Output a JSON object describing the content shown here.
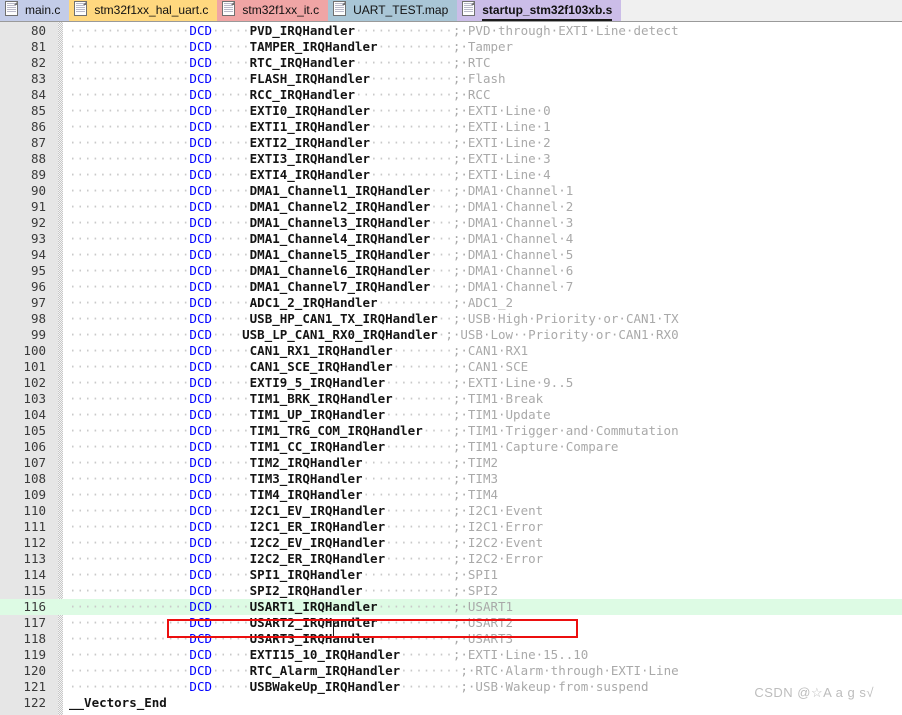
{
  "window": {
    "app": "Keil uVision editor",
    "background": "#ffffff"
  },
  "tabbar": {
    "tabs": [
      {
        "label": "main.c",
        "color": "#c3cce8",
        "icon": "document-icon",
        "active": false
      },
      {
        "label": "stm32f1xx_hal_uart.c",
        "color": "#ffd87f",
        "icon": "document-icon",
        "active": false
      },
      {
        "label": "stm32f1xx_it.c",
        "color": "#f0a5a5",
        "icon": "document-icon",
        "active": false
      },
      {
        "label": "UART_TEST.map",
        "color": "#a9c6d6",
        "icon": "document-icon",
        "active": false
      },
      {
        "label": "startup_stm32f103xb.s",
        "color": "#cbbde8",
        "icon": "document-icon",
        "active": true
      }
    ]
  },
  "editor": {
    "first_line": 80,
    "highlighted_line": 116,
    "colors": {
      "keyword": "#0000ff",
      "comment": "#a9a9a9",
      "whitespace_dot": "#c9c9c9",
      "highlight_row": "#ddfbe4",
      "annotation_box": "#ec0f0f",
      "gutter": "#e6e6e6"
    },
    "annotation": {
      "type": "red-rectangle",
      "targets_line": 116,
      "target_text": "DCD     USART1_IRQHandler          ; USART1"
    },
    "lines": [
      {
        "n": 80,
        "indent": 16,
        "kw": "DCD",
        "gap1": 5,
        "sym": "PVD_IRQHandler",
        "gap2": 13,
        "cmt": "; PVD through EXTI Line detect"
      },
      {
        "n": 81,
        "indent": 16,
        "kw": "DCD",
        "gap1": 5,
        "sym": "TAMPER_IRQHandler",
        "gap2": 10,
        "cmt": "; Tamper"
      },
      {
        "n": 82,
        "indent": 16,
        "kw": "DCD",
        "gap1": 5,
        "sym": "RTC_IRQHandler",
        "gap2": 13,
        "cmt": "; RTC"
      },
      {
        "n": 83,
        "indent": 16,
        "kw": "DCD",
        "gap1": 5,
        "sym": "FLASH_IRQHandler",
        "gap2": 11,
        "cmt": "; Flash"
      },
      {
        "n": 84,
        "indent": 16,
        "kw": "DCD",
        "gap1": 5,
        "sym": "RCC_IRQHandler",
        "gap2": 13,
        "cmt": "; RCC"
      },
      {
        "n": 85,
        "indent": 16,
        "kw": "DCD",
        "gap1": 5,
        "sym": "EXTI0_IRQHandler",
        "gap2": 11,
        "cmt": "; EXTI Line 0"
      },
      {
        "n": 86,
        "indent": 16,
        "kw": "DCD",
        "gap1": 5,
        "sym": "EXTI1_IRQHandler",
        "gap2": 11,
        "cmt": "; EXTI Line 1"
      },
      {
        "n": 87,
        "indent": 16,
        "kw": "DCD",
        "gap1": 5,
        "sym": "EXTI2_IRQHandler",
        "gap2": 11,
        "cmt": "; EXTI Line 2"
      },
      {
        "n": 88,
        "indent": 16,
        "kw": "DCD",
        "gap1": 5,
        "sym": "EXTI3_IRQHandler",
        "gap2": 11,
        "cmt": "; EXTI Line 3"
      },
      {
        "n": 89,
        "indent": 16,
        "kw": "DCD",
        "gap1": 5,
        "sym": "EXTI4_IRQHandler",
        "gap2": 11,
        "cmt": "; EXTI Line 4"
      },
      {
        "n": 90,
        "indent": 16,
        "kw": "DCD",
        "gap1": 5,
        "sym": "DMA1_Channel1_IRQHandler",
        "gap2": 3,
        "cmt": "; DMA1 Channel 1"
      },
      {
        "n": 91,
        "indent": 16,
        "kw": "DCD",
        "gap1": 5,
        "sym": "DMA1_Channel2_IRQHandler",
        "gap2": 3,
        "cmt": "; DMA1 Channel 2"
      },
      {
        "n": 92,
        "indent": 16,
        "kw": "DCD",
        "gap1": 5,
        "sym": "DMA1_Channel3_IRQHandler",
        "gap2": 3,
        "cmt": "; DMA1 Channel 3"
      },
      {
        "n": 93,
        "indent": 16,
        "kw": "DCD",
        "gap1": 5,
        "sym": "DMA1_Channel4_IRQHandler",
        "gap2": 3,
        "cmt": "; DMA1 Channel 4"
      },
      {
        "n": 94,
        "indent": 16,
        "kw": "DCD",
        "gap1": 5,
        "sym": "DMA1_Channel5_IRQHandler",
        "gap2": 3,
        "cmt": "; DMA1 Channel 5"
      },
      {
        "n": 95,
        "indent": 16,
        "kw": "DCD",
        "gap1": 5,
        "sym": "DMA1_Channel6_IRQHandler",
        "gap2": 3,
        "cmt": "; DMA1 Channel 6"
      },
      {
        "n": 96,
        "indent": 16,
        "kw": "DCD",
        "gap1": 5,
        "sym": "DMA1_Channel7_IRQHandler",
        "gap2": 3,
        "cmt": "; DMA1 Channel 7"
      },
      {
        "n": 97,
        "indent": 16,
        "kw": "DCD",
        "gap1": 5,
        "sym": "ADC1_2_IRQHandler",
        "gap2": 10,
        "cmt": "; ADC1_2"
      },
      {
        "n": 98,
        "indent": 16,
        "kw": "DCD",
        "gap1": 5,
        "sym": "USB_HP_CAN1_TX_IRQHandler",
        "gap2": 2,
        "cmt": "; USB High Priority or CAN1 TX"
      },
      {
        "n": 99,
        "indent": 16,
        "kw": "DCD",
        "gap1": 4,
        "sym": "USB_LP_CAN1_RX0_IRQHandler",
        "gap2": 1,
        "cmt": "; USB Low  Priority or CAN1 RX0"
      },
      {
        "n": 100,
        "indent": 16,
        "kw": "DCD",
        "gap1": 5,
        "sym": "CAN1_RX1_IRQHandler",
        "gap2": 8,
        "cmt": "; CAN1 RX1"
      },
      {
        "n": 101,
        "indent": 16,
        "kw": "DCD",
        "gap1": 5,
        "sym": "CAN1_SCE_IRQHandler",
        "gap2": 8,
        "cmt": "; CAN1 SCE"
      },
      {
        "n": 102,
        "indent": 16,
        "kw": "DCD",
        "gap1": 5,
        "sym": "EXTI9_5_IRQHandler",
        "gap2": 9,
        "cmt": "; EXTI Line 9..5"
      },
      {
        "n": 103,
        "indent": 16,
        "kw": "DCD",
        "gap1": 5,
        "sym": "TIM1_BRK_IRQHandler",
        "gap2": 8,
        "cmt": "; TIM1 Break"
      },
      {
        "n": 104,
        "indent": 16,
        "kw": "DCD",
        "gap1": 5,
        "sym": "TIM1_UP_IRQHandler",
        "gap2": 9,
        "cmt": "; TIM1 Update"
      },
      {
        "n": 105,
        "indent": 16,
        "kw": "DCD",
        "gap1": 5,
        "sym": "TIM1_TRG_COM_IRQHandler",
        "gap2": 4,
        "cmt": "; TIM1 Trigger and Commutation"
      },
      {
        "n": 106,
        "indent": 16,
        "kw": "DCD",
        "gap1": 5,
        "sym": "TIM1_CC_IRQHandler",
        "gap2": 9,
        "cmt": "; TIM1 Capture Compare"
      },
      {
        "n": 107,
        "indent": 16,
        "kw": "DCD",
        "gap1": 5,
        "sym": "TIM2_IRQHandler",
        "gap2": 12,
        "cmt": "; TIM2"
      },
      {
        "n": 108,
        "indent": 16,
        "kw": "DCD",
        "gap1": 5,
        "sym": "TIM3_IRQHandler",
        "gap2": 12,
        "cmt": "; TIM3"
      },
      {
        "n": 109,
        "indent": 16,
        "kw": "DCD",
        "gap1": 5,
        "sym": "TIM4_IRQHandler",
        "gap2": 12,
        "cmt": "; TIM4"
      },
      {
        "n": 110,
        "indent": 16,
        "kw": "DCD",
        "gap1": 5,
        "sym": "I2C1_EV_IRQHandler",
        "gap2": 9,
        "cmt": "; I2C1 Event"
      },
      {
        "n": 111,
        "indent": 16,
        "kw": "DCD",
        "gap1": 5,
        "sym": "I2C1_ER_IRQHandler",
        "gap2": 9,
        "cmt": "; I2C1 Error"
      },
      {
        "n": 112,
        "indent": 16,
        "kw": "DCD",
        "gap1": 5,
        "sym": "I2C2_EV_IRQHandler",
        "gap2": 9,
        "cmt": "; I2C2 Event"
      },
      {
        "n": 113,
        "indent": 16,
        "kw": "DCD",
        "gap1": 5,
        "sym": "I2C2_ER_IRQHandler",
        "gap2": 9,
        "cmt": "; I2C2 Error"
      },
      {
        "n": 114,
        "indent": 16,
        "kw": "DCD",
        "gap1": 5,
        "sym": "SPI1_IRQHandler",
        "gap2": 12,
        "cmt": "; SPI1"
      },
      {
        "n": 115,
        "indent": 16,
        "kw": "DCD",
        "gap1": 5,
        "sym": "SPI2_IRQHandler",
        "gap2": 12,
        "cmt": "; SPI2"
      },
      {
        "n": 116,
        "indent": 16,
        "kw": "DCD",
        "gap1": 5,
        "sym": "USART1_IRQHandler",
        "gap2": 10,
        "cmt": "; USART1",
        "highlight": true
      },
      {
        "n": 117,
        "indent": 16,
        "kw": "DCD",
        "gap1": 5,
        "sym": "USART2_IRQHandler",
        "gap2": 10,
        "cmt": "; USART2"
      },
      {
        "n": 118,
        "indent": 16,
        "kw": "DCD",
        "gap1": 5,
        "sym": "USART3_IRQHandler",
        "gap2": 10,
        "cmt": "; USART3"
      },
      {
        "n": 119,
        "indent": 16,
        "kw": "DCD",
        "gap1": 5,
        "sym": "EXTI15_10_IRQHandler",
        "gap2": 7,
        "cmt": "; EXTI Line 15..10"
      },
      {
        "n": 120,
        "indent": 16,
        "kw": "DCD",
        "gap1": 5,
        "sym": "RTC_Alarm_IRQHandler",
        "gap2": 8,
        "cmt": "; RTC Alarm through EXTI Line"
      },
      {
        "n": 121,
        "indent": 16,
        "kw": "DCD",
        "gap1": 5,
        "sym": "USBWakeUp_IRQHandler",
        "gap2": 8,
        "cmt": "; USB Wakeup from suspend"
      },
      {
        "n": 122,
        "indent": 0,
        "kw": "",
        "gap1": 0,
        "sym": "__Vectors_End",
        "gap2": 0,
        "cmt": ""
      }
    ]
  },
  "watermark": {
    "text": "CSDN @☆A a g s√"
  }
}
